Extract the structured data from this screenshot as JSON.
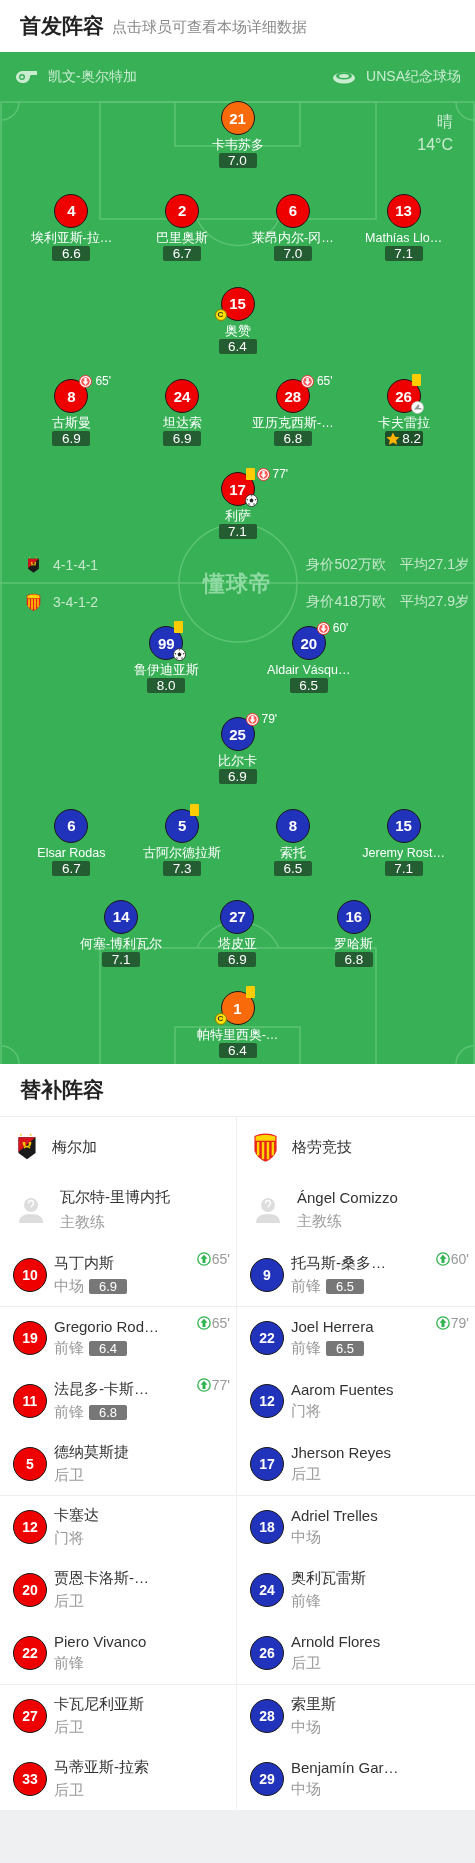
{
  "header": {
    "title": "首发阵容",
    "hint": "点击球员可查看本场详细数据"
  },
  "pitch": {
    "referee": "凯文-奥尔特加",
    "stadium": "UNSA纪念球场",
    "weather": "晴",
    "temperature": "14°C",
    "center_logo": "懂球帝"
  },
  "lineup": {
    "home": {
      "color": "#ee0000",
      "formation": "4-1-4-1",
      "market_value": "身价502万欧",
      "average_age": "平均27.1岁",
      "rows": [
        [
          {
            "number": "21",
            "name": "卡韦苏多",
            "rating": "7.0",
            "goalkeeper": true,
            "captain": false,
            "yellow_card": false,
            "goal": false,
            "assist": false,
            "best": false
          }
        ],
        [
          {
            "number": "4",
            "name": "埃利亚斯-拉…",
            "rating": "6.6",
            "goalkeeper": false,
            "captain": false,
            "yellow_card": false,
            "goal": false,
            "assist": false,
            "best": false
          },
          {
            "number": "2",
            "name": "巴里奥斯",
            "rating": "6.7",
            "goalkeeper": false,
            "captain": false,
            "yellow_card": false,
            "goal": false,
            "assist": false,
            "best": false
          },
          {
            "number": "6",
            "name": "莱昂内尔-冈…",
            "rating": "7.0",
            "goalkeeper": false,
            "captain": false,
            "yellow_card": false,
            "goal": false,
            "assist": false,
            "best": false
          },
          {
            "number": "13",
            "name": "Mathías Llo…",
            "rating": "7.1",
            "goalkeeper": false,
            "captain": false,
            "yellow_card": false,
            "goal": false,
            "assist": false,
            "best": false
          }
        ],
        [
          {
            "number": "15",
            "name": "奥赞",
            "rating": "6.4",
            "goalkeeper": false,
            "captain": true,
            "captain_badge": "C",
            "yellow_card": false,
            "goal": false,
            "assist": false,
            "best": false
          }
        ],
        [
          {
            "number": "8",
            "name": "古斯曼",
            "rating": "6.9",
            "goalkeeper": false,
            "captain": false,
            "yellow_card": false,
            "goal": false,
            "assist": false,
            "best": false,
            "sub_off": "65'"
          },
          {
            "number": "24",
            "name": "坦达索",
            "rating": "6.9",
            "goalkeeper": false,
            "captain": false,
            "yellow_card": false,
            "goal": false,
            "assist": false,
            "best": false
          },
          {
            "number": "28",
            "name": "亚历克西斯-…",
            "rating": "6.8",
            "goalkeeper": false,
            "captain": false,
            "yellow_card": false,
            "goal": false,
            "assist": false,
            "best": false,
            "sub_off": "65'"
          },
          {
            "number": "26",
            "name": "卡夫雷拉",
            "rating": "8.2",
            "goalkeeper": false,
            "captain": false,
            "yellow_card": true,
            "goal": false,
            "assist": true,
            "best": true
          }
        ],
        [
          {
            "number": "17",
            "name": "利萨",
            "rating": "7.1",
            "goalkeeper": false,
            "captain": false,
            "yellow_card": true,
            "goal": true,
            "assist": false,
            "best": false,
            "sub_off": "77'"
          }
        ]
      ]
    },
    "away": {
      "color": "#2233bb",
      "formation": "3-4-1-2",
      "market_value": "身价418万欧",
      "average_age": "平均27.9岁",
      "rows": [
        [
          {
            "number": "99",
            "name": "鲁伊迪亚斯",
            "rating": "8.0",
            "goalkeeper": false,
            "captain": false,
            "yellow_card": true,
            "goal": true,
            "assist": false,
            "best": false
          },
          {
            "number": "20",
            "name": "Aldair Vásqu…",
            "rating": "6.5",
            "goalkeeper": false,
            "captain": false,
            "yellow_card": false,
            "goal": false,
            "assist": false,
            "best": false,
            "sub_off": "60'"
          }
        ],
        [
          {
            "number": "25",
            "name": "比尔卡",
            "rating": "6.9",
            "goalkeeper": false,
            "captain": false,
            "yellow_card": false,
            "goal": false,
            "assist": false,
            "best": false,
            "sub_off": "79'"
          }
        ],
        [
          {
            "number": "6",
            "name": "Elsar Rodas",
            "rating": "6.7",
            "goalkeeper": false,
            "captain": false,
            "yellow_card": false,
            "goal": false,
            "assist": false,
            "best": false
          },
          {
            "number": "5",
            "name": "古阿尔德拉斯",
            "rating": "7.3",
            "goalkeeper": false,
            "captain": false,
            "yellow_card": true,
            "goal": false,
            "assist": false,
            "best": false
          },
          {
            "number": "8",
            "name": "索托",
            "rating": "6.5",
            "goalkeeper": false,
            "captain": false,
            "yellow_card": false,
            "goal": false,
            "assist": false,
            "best": false
          },
          {
            "number": "15",
            "name": "Jeremy Rost…",
            "rating": "7.1",
            "goalkeeper": false,
            "captain": false,
            "yellow_card": false,
            "goal": false,
            "assist": false,
            "best": false
          }
        ],
        [
          {
            "number": "14",
            "name": "何塞-博利瓦尔",
            "rating": "7.1",
            "goalkeeper": false,
            "captain": false,
            "yellow_card": false,
            "goal": false,
            "assist": false,
            "best": false
          },
          {
            "number": "27",
            "name": "塔皮亚",
            "rating": "6.9",
            "goalkeeper": false,
            "captain": false,
            "yellow_card": false,
            "goal": false,
            "assist": false,
            "best": false
          },
          {
            "number": "16",
            "name": "罗哈斯",
            "rating": "6.8",
            "goalkeeper": false,
            "captain": false,
            "yellow_card": false,
            "goal": false,
            "assist": false,
            "best": false
          }
        ],
        [
          {
            "number": "1",
            "name": "帕特里西奥-…",
            "rating": "6.4",
            "goalkeeper": true,
            "captain": true,
            "captain_badge": "C",
            "yellow_card": true,
            "goal": false,
            "assist": false,
            "best": false
          }
        ]
      ]
    }
  },
  "substitutes": {
    "title": "替补阵容",
    "home": {
      "team": "梅尔加",
      "coach": "瓦尔特-里博内托",
      "coach_role": "主教练",
      "players": [
        {
          "number": "10",
          "name": "马丁内斯",
          "position": "中场",
          "rating": "6.9",
          "sub_on": "65'"
        },
        {
          "number": "19",
          "name": "Gregorio Rod…",
          "position": "前锋",
          "rating": "6.4",
          "sub_on": "65'"
        },
        {
          "number": "11",
          "name": "法昆多-卡斯…",
          "position": "前锋",
          "rating": "6.8",
          "sub_on": "77'"
        },
        {
          "number": "5",
          "name": "德纳莫斯捷",
          "position": "后卫"
        },
        {
          "number": "12",
          "name": "卡塞达",
          "position": "门将"
        },
        {
          "number": "20",
          "name": "贾恩卡洛斯-…",
          "position": "后卫"
        },
        {
          "number": "22",
          "name": "Piero Vivanco",
          "position": "前锋"
        },
        {
          "number": "27",
          "name": "卡瓦尼利亚斯",
          "position": "后卫"
        },
        {
          "number": "33",
          "name": "马蒂亚斯-拉索",
          "position": "后卫"
        }
      ]
    },
    "away": {
      "team": "格劳竞技",
      "coach": "Ángel Comizzo",
      "coach_role": "主教练",
      "players": [
        {
          "number": "9",
          "name": "托马斯-桑多…",
          "position": "前锋",
          "rating": "6.5",
          "sub_on": "60'"
        },
        {
          "number": "22",
          "name": "Joel Herrera",
          "position": "前锋",
          "rating": "6.5",
          "sub_on": "79'"
        },
        {
          "number": "12",
          "name": "Aarom Fuentes",
          "position": "门将"
        },
        {
          "number": "17",
          "name": "Jherson Reyes",
          "position": "后卫"
        },
        {
          "number": "18",
          "name": "Adriel Trelles",
          "position": "中场"
        },
        {
          "number": "24",
          "name": "奥利瓦雷斯",
          "position": "前锋"
        },
        {
          "number": "26",
          "name": "Arnold Flores",
          "position": "后卫"
        },
        {
          "number": "28",
          "name": "索里斯",
          "position": "中场"
        },
        {
          "number": "29",
          "name": "Benjamín Gar…",
          "position": "中场"
        }
      ]
    }
  }
}
